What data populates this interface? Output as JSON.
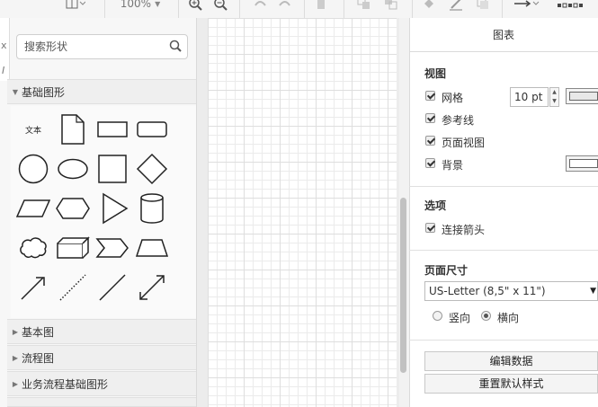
{
  "toolbar": {
    "zoom": "100%",
    "icons": [
      "page-view-icon",
      "zoom-in-icon",
      "zoom-out-icon",
      "undo-icon",
      "redo-icon",
      "delete-icon",
      "to-front-icon",
      "to-back-icon",
      "fill-color-icon",
      "line-color-icon",
      "shadow-icon",
      "connection-icon",
      "waypoints-icon"
    ]
  },
  "sidebar": {
    "search_placeholder": "搜索形状",
    "sections": [
      {
        "label": "基础图形",
        "expanded": true
      },
      {
        "label": "基本图",
        "expanded": false
      },
      {
        "label": "流程图",
        "expanded": false
      },
      {
        "label": "业务流程基础图形",
        "expanded": false
      }
    ],
    "text_shape_label": "文本",
    "shapes": [
      "text",
      "note",
      "rectangle",
      "rounded-rectangle",
      "circle",
      "ellipse",
      "square",
      "diamond",
      "parallelogram",
      "hexagon",
      "triangle",
      "cylinder",
      "cloud",
      "cube",
      "step",
      "trapezoid",
      "arrow",
      "dotted-line",
      "line",
      "bidirectional-arrow"
    ]
  },
  "panel": {
    "title": "图表",
    "view": {
      "heading": "视图",
      "grid_label": "网格",
      "grid_size": "10 pt",
      "guides_label": "参考线",
      "page_view_label": "页面视图",
      "background_label": "背景"
    },
    "options": {
      "heading": "选项",
      "connection_arrows_label": "连接箭头"
    },
    "page_size": {
      "heading": "页面尺寸",
      "selected": "US-Letter (8,5\" x 11\")",
      "portrait_label": "竖向",
      "landscape_label": "横向",
      "orientation": "landscape"
    },
    "buttons": {
      "edit_data": "编辑数据",
      "reset_style": "重置默认样式"
    }
  },
  "colors": {
    "toolbar_bg": "#f5f5f5",
    "sidebar_bg": "#f7f7f7",
    "grid_line": "#ebebeb"
  }
}
